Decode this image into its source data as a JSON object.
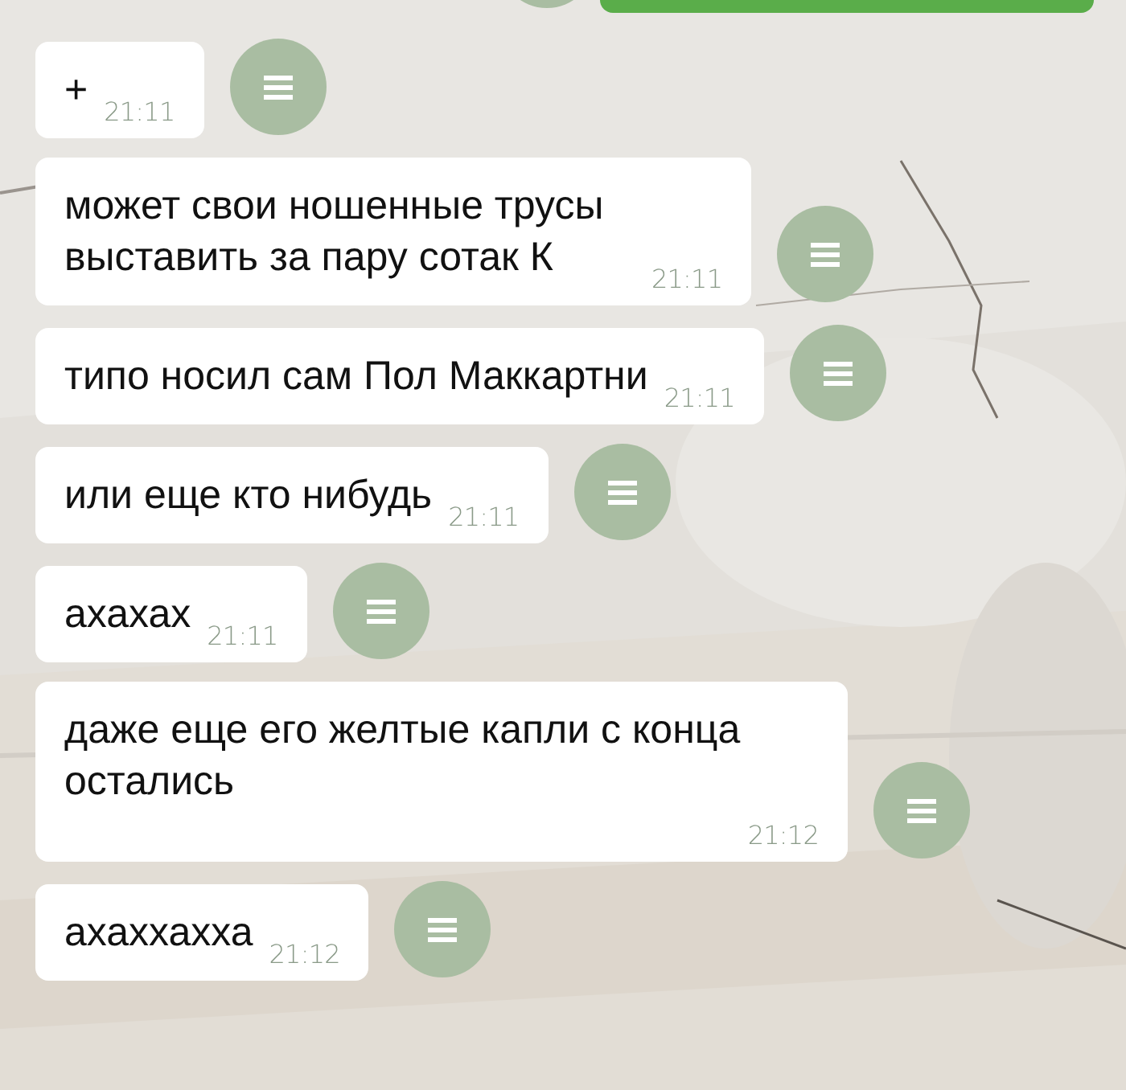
{
  "messages": [
    {
      "text": "+",
      "time": "21:11"
    },
    {
      "text": "может свои ношенные трусы выставить за пару сотак К",
      "time": "21:11"
    },
    {
      "text": "типо носил сам Пол Маккартни",
      "time": "21:11"
    },
    {
      "text": "или еще кто нибудь",
      "time": "21:11"
    },
    {
      "text": "ахахах",
      "time": "21:11"
    },
    {
      "text": "даже еще его желтые капли с конца остались",
      "time": "21:12"
    },
    {
      "text": "ахаххахха",
      "time": "21:12"
    }
  ]
}
